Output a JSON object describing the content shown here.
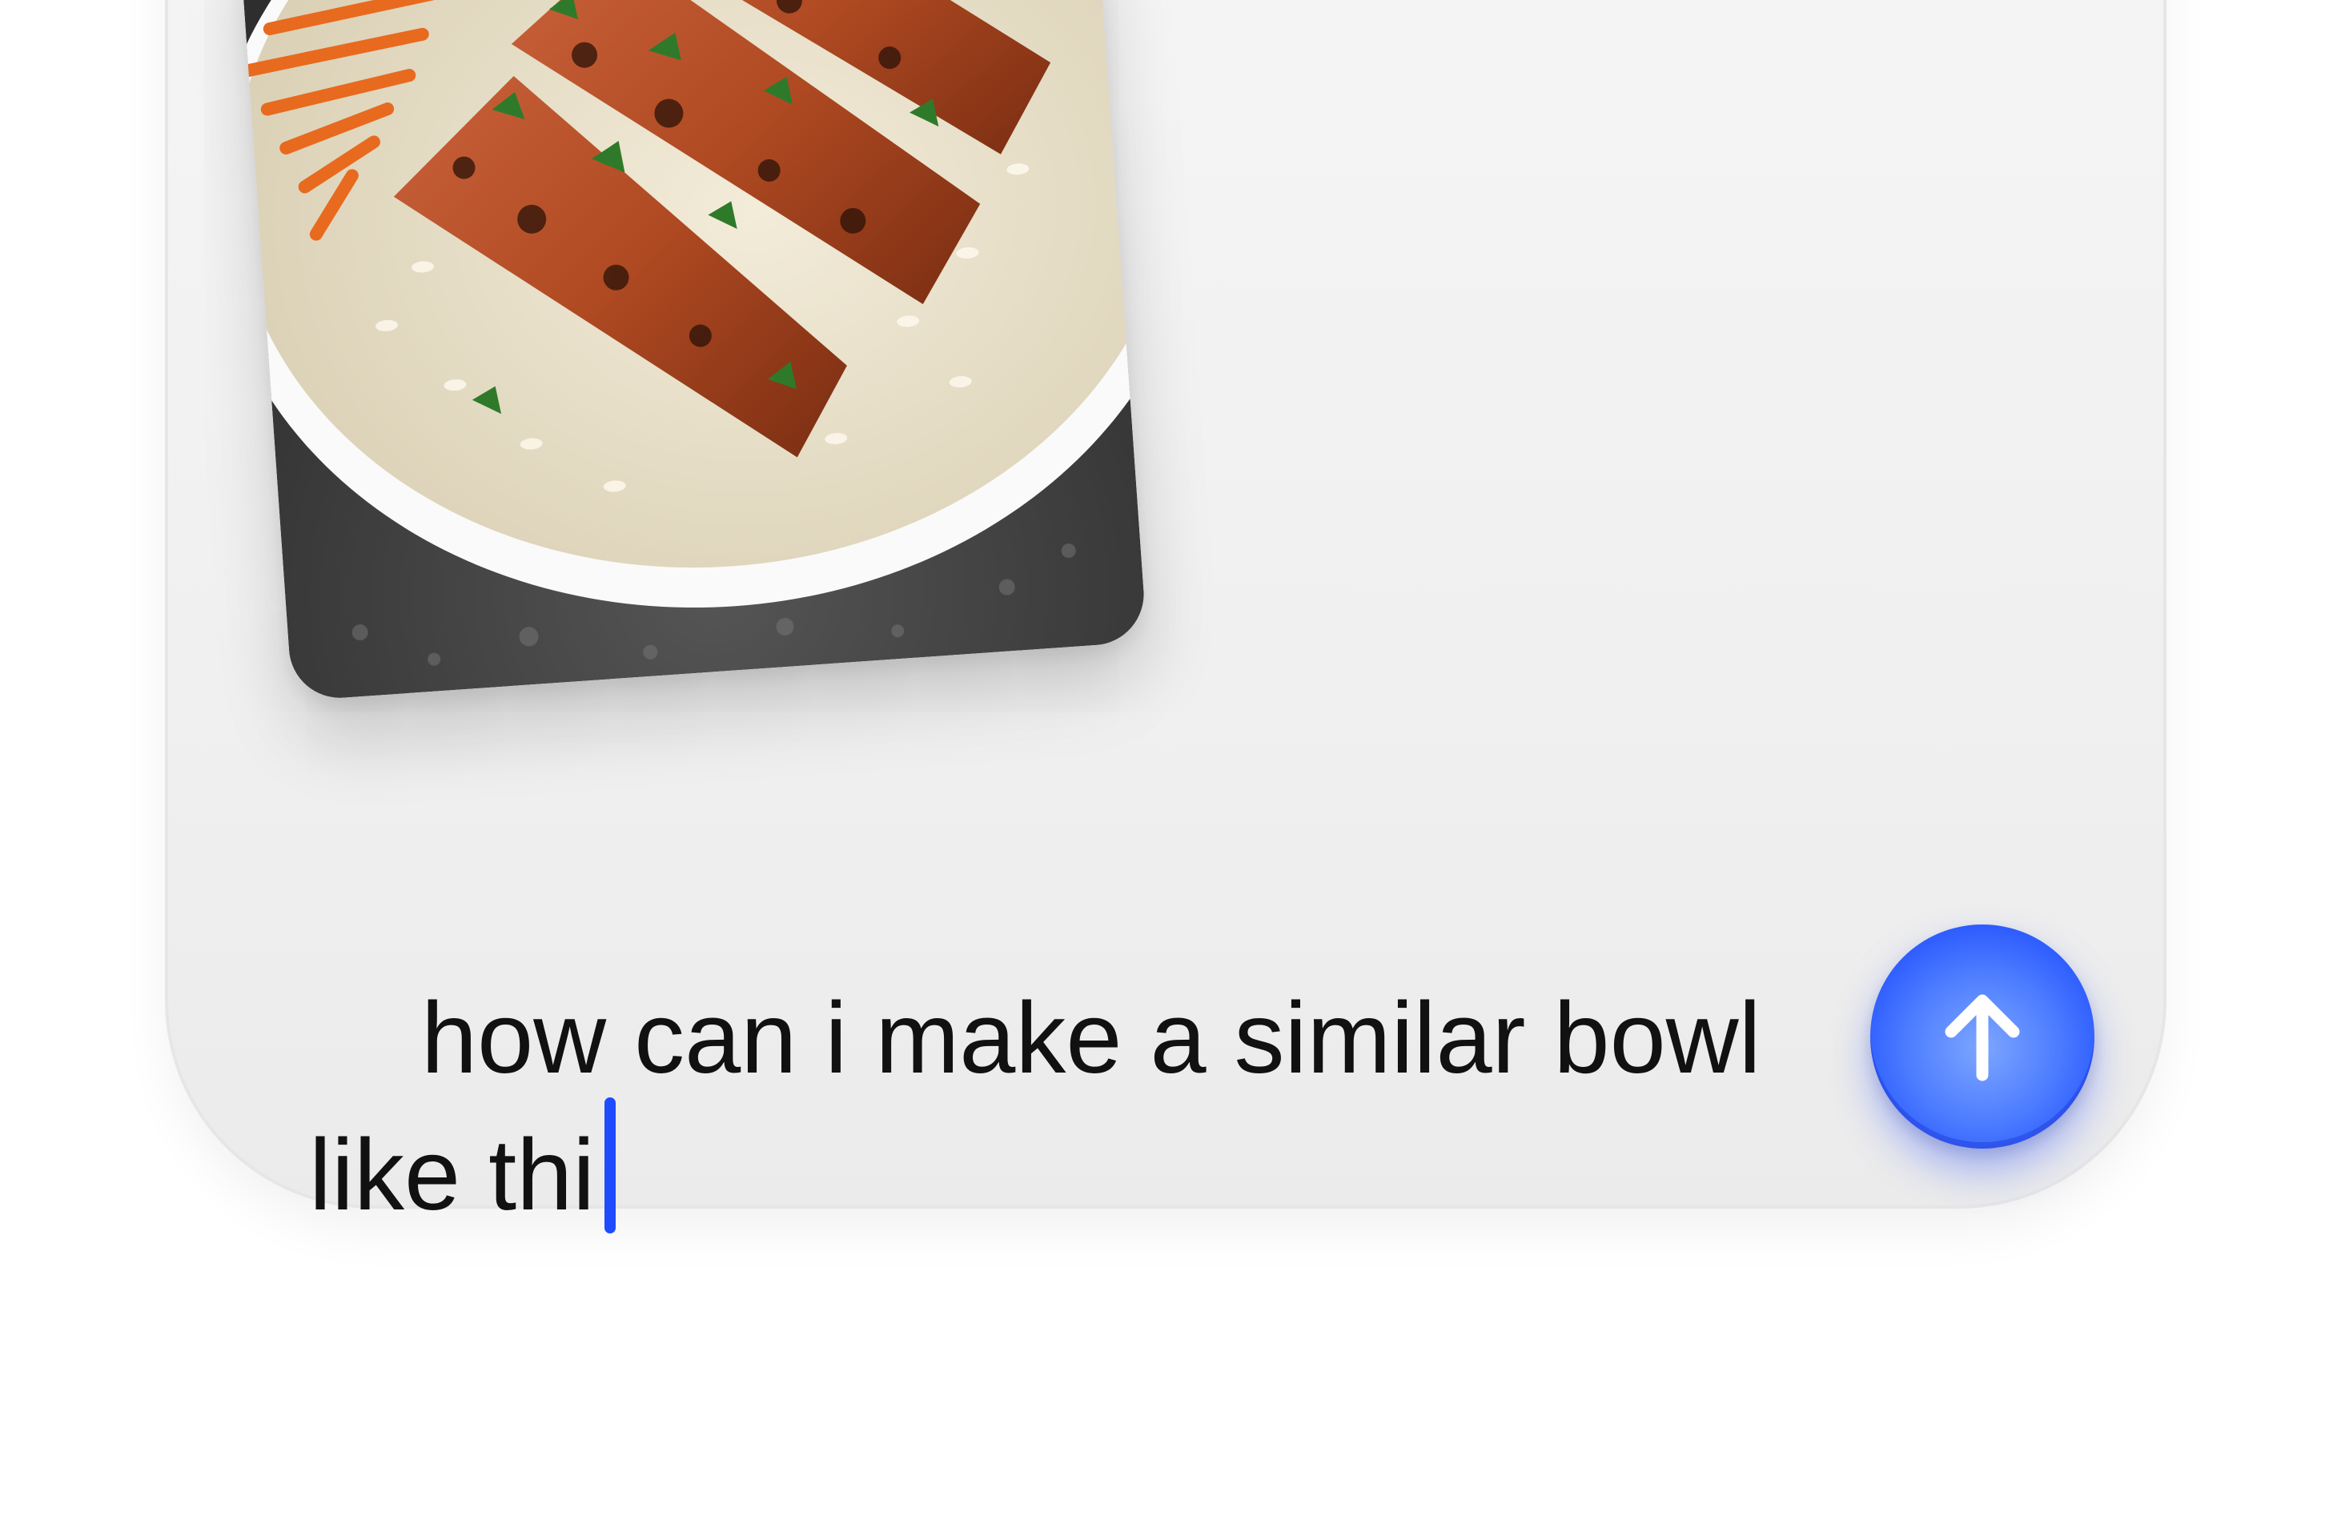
{
  "composer": {
    "message_text": "how can i make a similar bowl like thi",
    "send_button_icon": "arrow-up-icon",
    "accent_color": "#2654ff",
    "caret_color": "#1f4bff"
  },
  "attachment": {
    "type": "image",
    "subject": "photo"
  }
}
